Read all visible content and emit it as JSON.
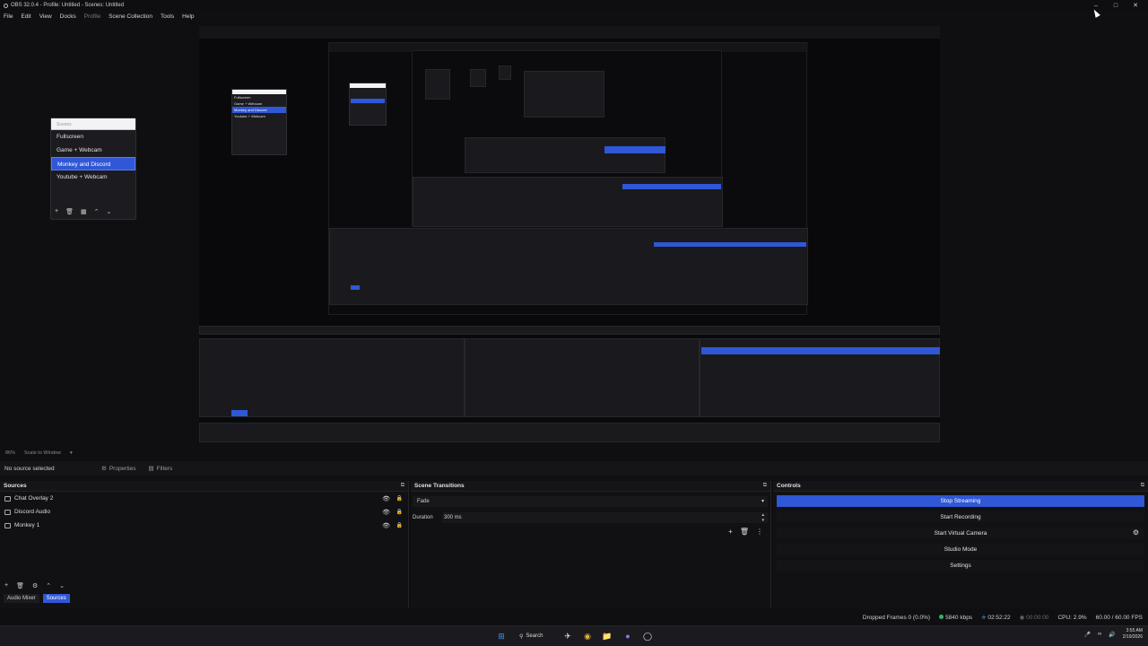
{
  "window": {
    "title": "OBS 32.0.4 - Profile: Untitled - Scenes: Untitled",
    "minimize": "–",
    "maximize": "□",
    "close": "✕"
  },
  "menu": [
    "File",
    "Edit",
    "View",
    "Docks",
    "Profile",
    "Scene Collection",
    "Tools",
    "Help"
  ],
  "scenes_dock": {
    "header": "Scenes",
    "items": [
      "Fullscreen",
      "Game + Webcam",
      "Monkey and Discord",
      "Youtube + Webcam"
    ],
    "selected_index": 2
  },
  "preview_toolbar": {
    "zoom": "86%",
    "scale": "Scale to Window"
  },
  "source_bar": {
    "no_source": "No source selected",
    "properties": "Properties",
    "filters": "Filters"
  },
  "sources": {
    "title": "Sources",
    "items": [
      "Chat Overlay 2",
      "Discord Audio",
      "Monkey 1"
    ],
    "tabs": [
      "Audio Mixer",
      "Sources"
    ],
    "active_tab": 1
  },
  "transitions": {
    "title": "Scene Transitions",
    "selected": "Fade",
    "duration_label": "Duration",
    "duration_value": "300 ms"
  },
  "controls": {
    "title": "Controls",
    "buttons": [
      "Stop Streaming",
      "Start Recording",
      "Start Virtual Camera",
      "Studio Mode",
      "Settings"
    ]
  },
  "status": {
    "dropped_frames": "Dropped Frames 0 (0.0%)",
    "bitrate": "5840 kbps",
    "stream_time": "02:52:22",
    "record_time": "00:00:00",
    "cpu": "CPU: 2.9%",
    "fps": "60.00 / 60.00 FPS"
  },
  "taskbar": {
    "search": "Search",
    "time": "3:55 AM",
    "date": "2/19/2026"
  },
  "colors": {
    "accent": "#2f57d6",
    "stream_dot": "#2fb36a",
    "record_dot": "#555555"
  }
}
